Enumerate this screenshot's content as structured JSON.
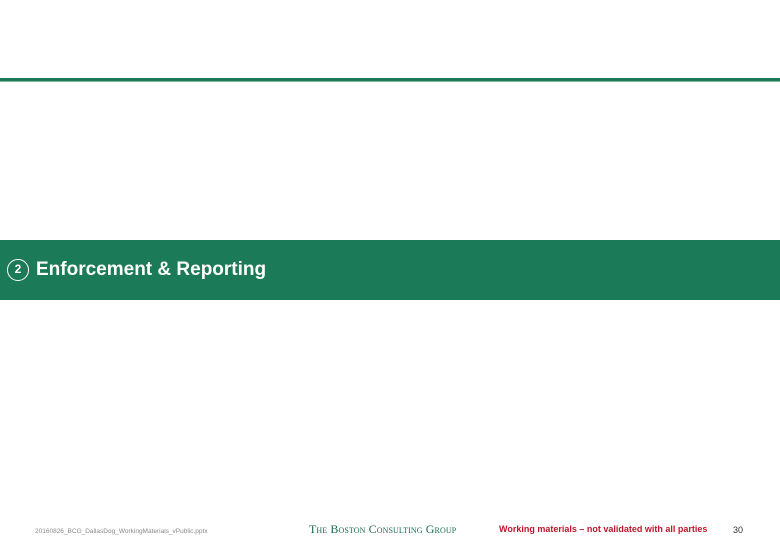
{
  "section": {
    "number": "2",
    "title": "Enforcement & Reporting"
  },
  "footer": {
    "filename": "20160826_BCG_DallasDog_WorkingMaterials_vPublic.pptx",
    "logo": "The Boston Consulting Group",
    "disclaimer": "Working materials – not validated with all parties",
    "page_number": "30"
  },
  "colors": {
    "brand_green": "#1b7a57",
    "disclaimer_red": "#c0172b"
  }
}
